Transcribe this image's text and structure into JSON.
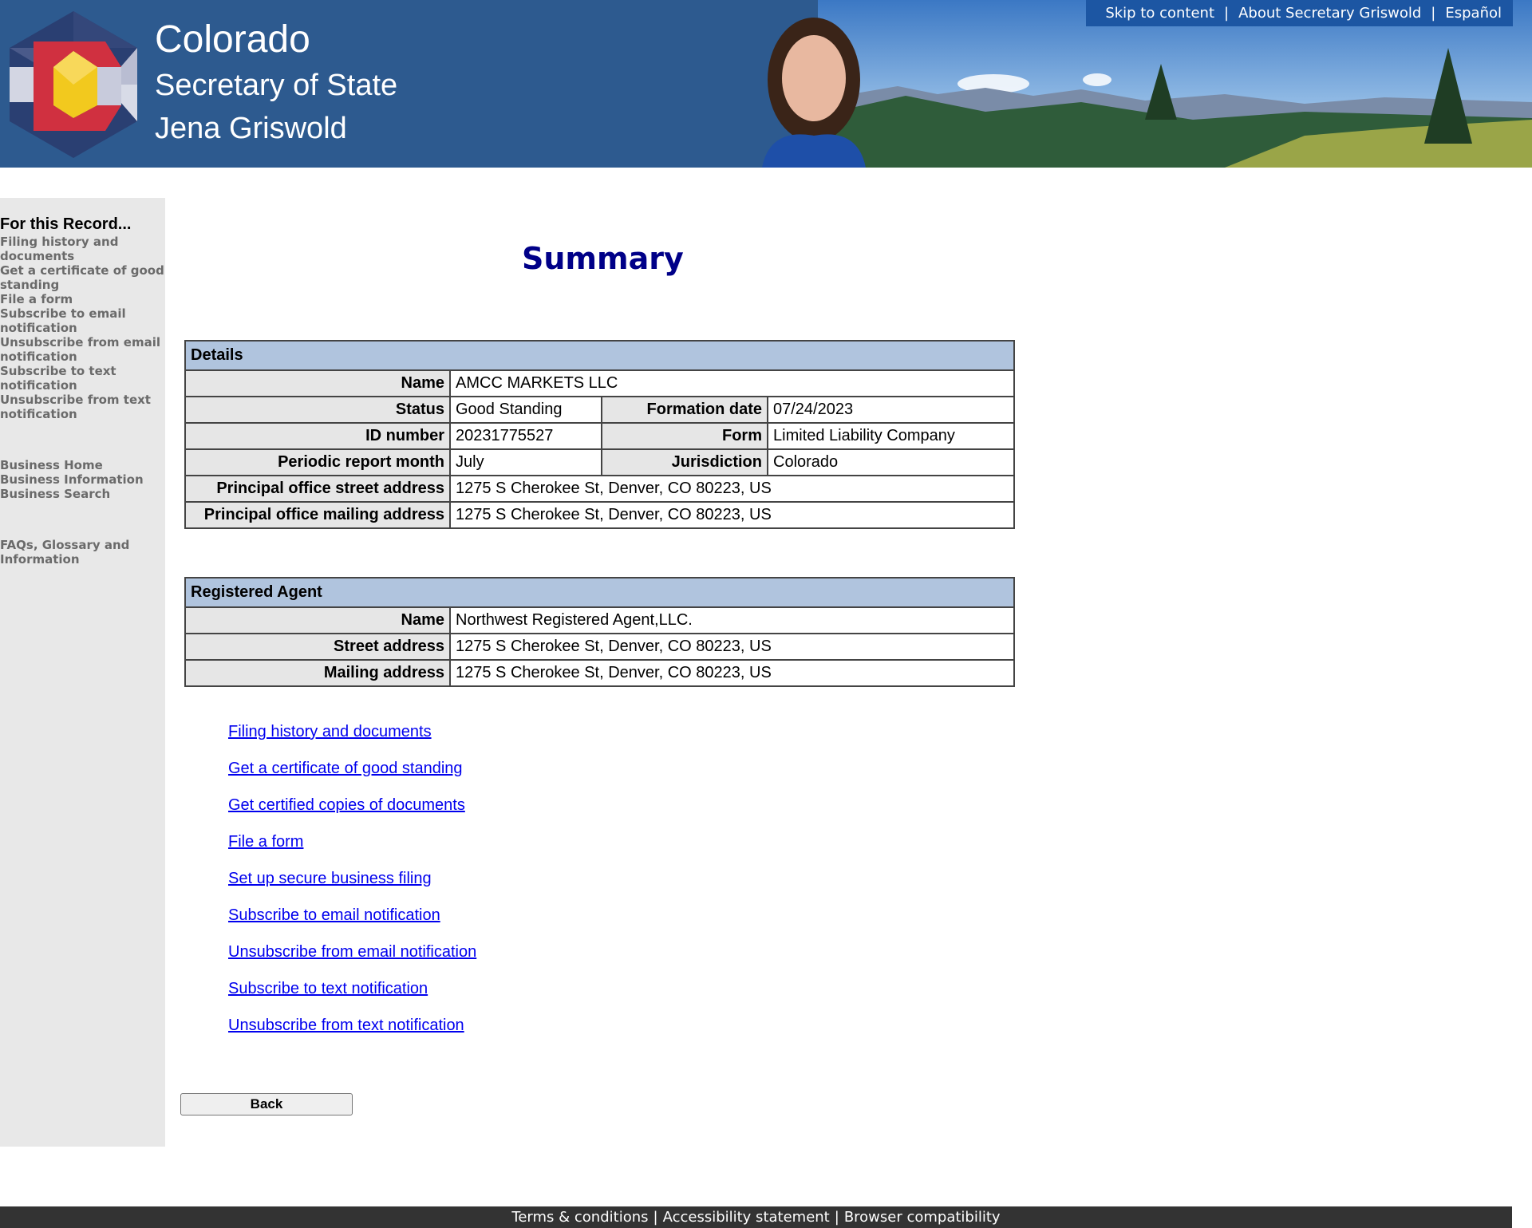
{
  "header": {
    "brand_lines": [
      "Colorado",
      "Secretary of State",
      "Jena Griswold"
    ],
    "top_links": [
      "Skip to content",
      "About Secretary Griswold",
      "Español"
    ],
    "separator": "|",
    "colors": {
      "banner": "#2d5a8f",
      "top_links_bg": "#1c56a3"
    }
  },
  "sidebar": {
    "heading": "For this Record...",
    "record_links": [
      "Filing history and documents",
      "Get a certificate of good standing",
      "File a form",
      "Subscribe to email notification",
      "Unsubscribe from email notification",
      "Subscribe to text notification",
      "Unsubscribe from text notification"
    ],
    "business_links": [
      "Business Home",
      "Business Information",
      "Business Search"
    ],
    "info_links": [
      "FAQs, Glossary and Information"
    ]
  },
  "main": {
    "title": "Summary",
    "details": {
      "heading": "Details",
      "name_label": "Name",
      "name": "AMCC MARKETS LLC",
      "status_label": "Status",
      "status": "Good Standing",
      "formation_date_label": "Formation date",
      "formation_date": "07/24/2023",
      "id_label": "ID number",
      "id": "20231775527",
      "form_label": "Form",
      "form": "Limited Liability Company",
      "periodic_label": "Periodic report month",
      "periodic": "July",
      "jurisdiction_label": "Jurisdiction",
      "jurisdiction": "Colorado",
      "street_label": "Principal office street address",
      "street": "1275 S Cherokee St, Denver, CO 80223, US",
      "mailing_label": "Principal office mailing address",
      "mailing": "1275 S Cherokee St, Denver, CO 80223, US"
    },
    "agent": {
      "heading": "Registered Agent",
      "name_label": "Name",
      "name": "Northwest Registered Agent,LLC.",
      "street_label": "Street address",
      "street": "1275 S Cherokee St, Denver, CO 80223, US",
      "mailing_label": "Mailing address",
      "mailing": "1275 S Cherokee St, Denver, CO 80223, US"
    },
    "links": [
      "Filing history and documents",
      "Get a certificate of good standing",
      "Get certified copies of documents",
      "File a form",
      "Set up secure business filing",
      "Subscribe to email notification",
      "Unsubscribe from email notification",
      "Subscribe to text notification",
      "Unsubscribe from text notification"
    ],
    "back_label": "Back"
  },
  "footer": {
    "links": [
      "Terms & conditions",
      "Accessibility statement",
      "Browser compatibility"
    ],
    "separator": "|"
  }
}
